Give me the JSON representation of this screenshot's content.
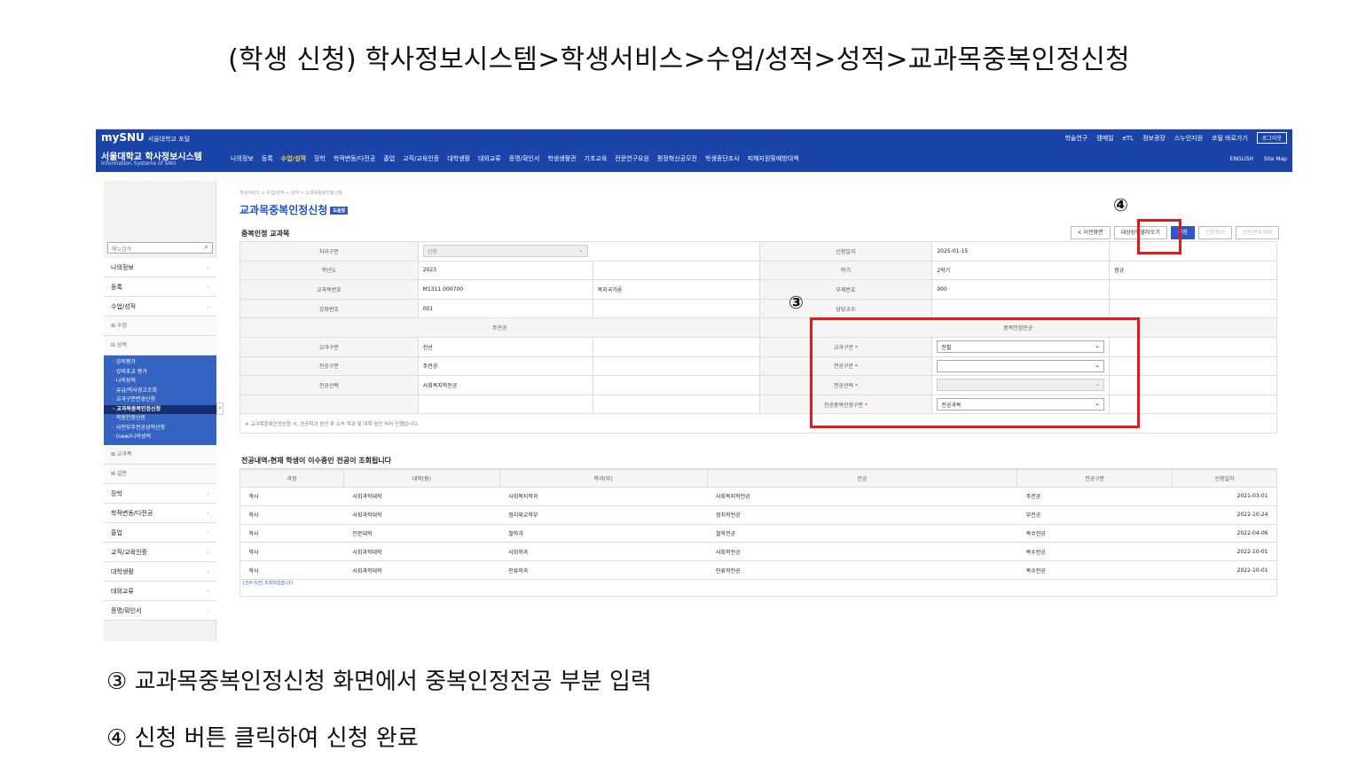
{
  "heading": "(학생 신청) 학사정보시스템>학생서비스>수업/성적>성적>교과목중복인정신청",
  "topbar": {
    "logo": "mySNU",
    "portal": "서울대학교 포털",
    "system_name": "서울대학교 학사정보시스템",
    "system_name_en": "Information Systems of SNU",
    "util_links": [
      "학술연구",
      "캠메일",
      "eTL",
      "정보광장",
      "스누인지원",
      "포털 바로가기"
    ],
    "logout": "로그아웃",
    "gnb": [
      "나의정보",
      "등록",
      "수업/성적",
      "장학",
      "학적변동/다전공",
      "졸업",
      "교직/교육인증",
      "대학생활",
      "대외교류",
      "증명/확인서",
      "학생생활관",
      "기초교육",
      "전문연구요원",
      "평정혁신공모전",
      "학생종단조사",
      "피해지원및예방대책"
    ],
    "gnb_active_index": 2,
    "lang_links": [
      "ENGLISH",
      "Site Map"
    ]
  },
  "sidebar": {
    "search_placeholder": "메뉴검색",
    "items": [
      {
        "label": "나의정보"
      },
      {
        "label": "등록"
      },
      {
        "label": "수업/성적"
      }
    ],
    "sub_class": "⊞ 수업",
    "sub_grade": "⊟ 성적",
    "grade_menu": [
      "· 강의평가",
      "· 강의초교 평가",
      "· 나의성적",
      "· 유급/학사경고조회",
      "· 교과구분변경신청",
      "· 교과목중복인정신청",
      "· 학점인정신청",
      "· 사전부주전공성적신청",
      "· (new)나의성적"
    ],
    "grade_menu_selected": 5,
    "sub_subject": "⊞ 교과목",
    "sub_survey": "⊞ 설문",
    "bottom_items": [
      "장학",
      "학적변동/다전공",
      "졸업",
      "교직/교육인증",
      "대학생활",
      "대외교류",
      "증명/확인서"
    ]
  },
  "main": {
    "breadcrumb": "학생서비스 > 수업/성적 > 성적 > 교과목중복인정신청",
    "title": "교과목중복인정신청",
    "manual": "도움말",
    "section1": "중복인정 교과목",
    "buttons": {
      "prev": "< 이전화면",
      "load": "대상성적불러오기",
      "apply": "신청",
      "cancel": "신청취소",
      "delete": "승인완료삭제"
    },
    "form": {
      "process_type_label": "처리구분",
      "process_type_value": "신청",
      "apply_date_label": "신청일자",
      "apply_date_value": "2025-01-15",
      "year_label": "학년도",
      "year_value": "2023",
      "term_label": "학기",
      "term_value": "2학기",
      "term_extra": "정규",
      "course_no_label": "교과목번호",
      "course_no_value": "M1311.000700",
      "course_name": "복지국가론",
      "section_no_label": "부제번호",
      "section_no_value": "000",
      "lecture_no_label": "강좌번호",
      "lecture_no_value": "001",
      "professor_label": "담당교수",
      "major_header": "주전공",
      "dup_header": "중복인정전공",
      "course_type_label": "교과구분",
      "course_type_value": "전선",
      "dup_course_type_label": "교과구분",
      "dup_course_type_value": "전필",
      "major_type_label": "전공구분",
      "major_type_value": "주전공",
      "dup_major_type_label": "전공구분",
      "dup_major_type_value": "",
      "major_select_label": "전공선택",
      "major_select_value": "사회복지학전공",
      "dup_major_select_label": "전공선택",
      "dup_major_select_value": "",
      "dup_recog_label": "전공중복인정구분",
      "dup_recog_value": "전공과목",
      "note": "※ 교과목중복인정신청 시, 전공학과 승인 후 소속 학과 및 대학 승인 처리 진행됩니다."
    },
    "section2": "전공내역-현재 학생이 이수중인 전공이 조회됩니다",
    "list_headers": [
      "과정",
      "대학(원)",
      "학과(부)",
      "전공",
      "전공구분",
      "신청일자"
    ],
    "list_rows": [
      [
        "학사",
        "사회과학대학",
        "사회복지학과",
        "사회복지학전공",
        "주전공",
        "2021-03-01"
      ],
      [
        "학사",
        "사회과학대학",
        "정치외교학부",
        "정치학전공",
        "부전공",
        "2022-10-24"
      ],
      [
        "학사",
        "인문대학",
        "철학과",
        "철학전공",
        "복수전공",
        "2022-04-06"
      ],
      [
        "학사",
        "사회과학대학",
        "사회학과",
        "사회학전공",
        "복수전공",
        "2022-10-01"
      ],
      [
        "학사",
        "사회과학대학",
        "인류학과",
        "인류학전공",
        "복수전공",
        "2022-10-01"
      ]
    ],
    "list_count": "[건수:5건] 조회되었습니다"
  },
  "step3": "③",
  "step4": "④",
  "caption3": "③ 교과목중복인정신청 화면에서 중복인정전공 부분 입력",
  "caption4": "④ 신청 버튼 클릭하여 신청 완료",
  "colors": {
    "nav_blue": "#1a44a8",
    "accent": "#2d59c8",
    "highlight_red": "#e01b1b"
  }
}
